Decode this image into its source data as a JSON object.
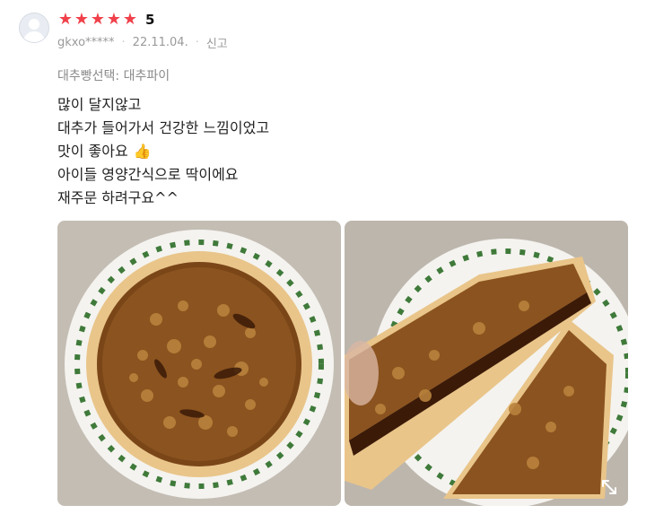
{
  "review": {
    "rating_stars": 5,
    "rating_value": "5",
    "user": "gkxo*****",
    "date": "22.11.04.",
    "report_label": "신고",
    "option": "대추빵선택: 대추파이",
    "lines": [
      "많이 달지않고",
      "대추가 들어가서 건강한 느낌이었고",
      "맛이 좋아요",
      "아이들 영양간식으로 딱이에요",
      "재주문 하려구요^^"
    ]
  },
  "colors": {
    "star": "#f0404a",
    "meta": "#9a9a9a"
  },
  "icons": {
    "avatar": "user-avatar-icon",
    "star": "star-icon",
    "thumb": "thumbs-up-icon",
    "expand": "expand-icon"
  }
}
